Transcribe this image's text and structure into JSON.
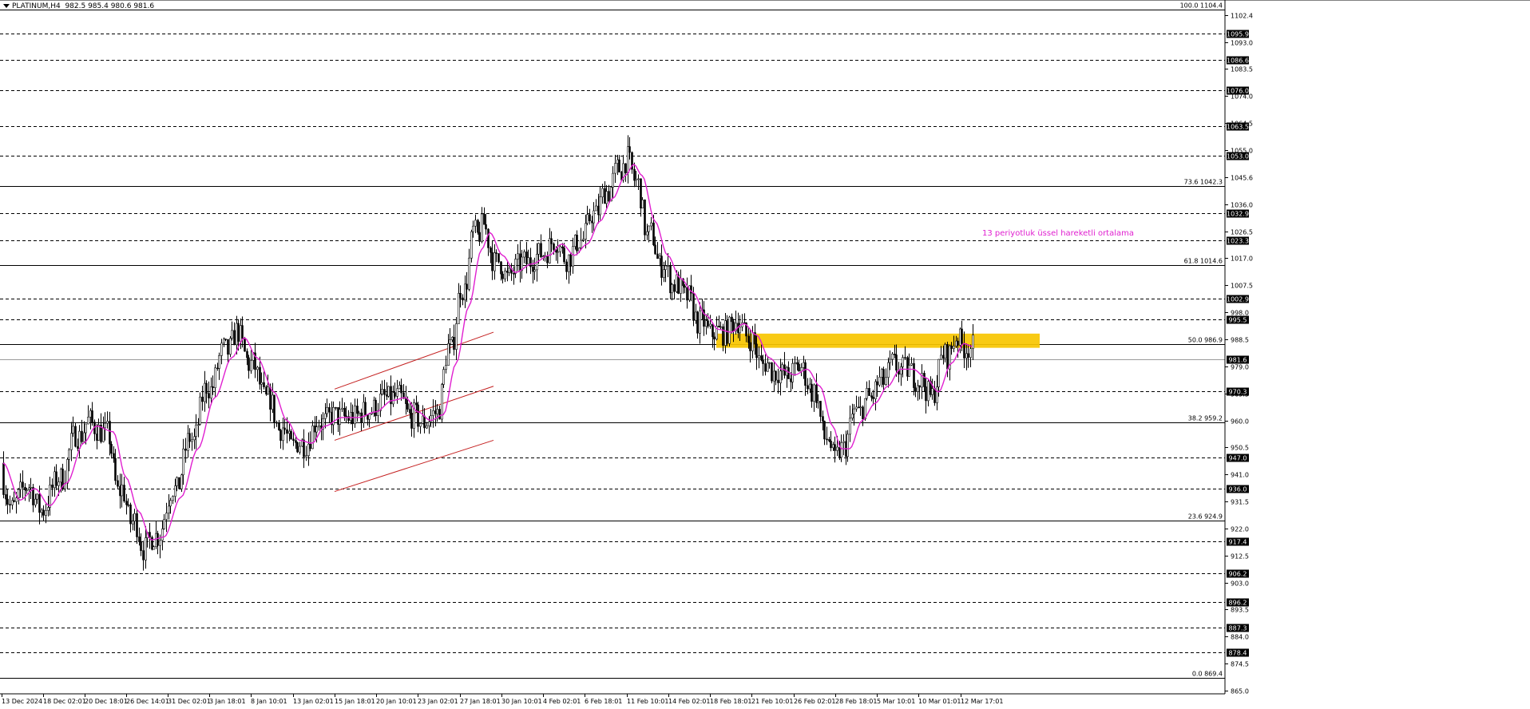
{
  "header": {
    "symbol": "PLATINUM,H4",
    "ohlc": "982.5 985.4 980.6 981.6"
  },
  "annotation_text": "13 periyotluk üssel hareketli ortalama",
  "colors": {
    "candle": "#000000",
    "ema": "#e020d0",
    "channel": "#c42020",
    "zone": "#f7c600",
    "price_tag_bg": "#000000",
    "price_tag_text": "#ffffff",
    "grid_line": "#000000",
    "background": "#ffffff"
  },
  "chart_data": {
    "type": "candlestick",
    "symbol": "PLATINUM",
    "timeframe": "H4",
    "ylim": [
      865.0,
      1104.4
    ],
    "current_price": 981.6,
    "yticks": [
      "1102.4",
      "1093.0",
      "1083.5",
      "1074.0",
      "1064.5",
      "1055.0",
      "1045.6",
      "1036.0",
      "1026.5",
      "1017.0",
      "1007.5",
      "998.0",
      "988.5",
      "979.0",
      "969.5",
      "960.0",
      "950.5",
      "941.0",
      "931.5",
      "922.0",
      "912.5",
      "903.0",
      "893.5",
      "884.0",
      "874.5",
      "865.0"
    ],
    "xticks": [
      "13 Dec 2024",
      "18 Dec 02:01",
      "20 Dec 18:01",
      "26 Dec 14:01",
      "31 Dec 02:01",
      "3 Jan 18:01",
      "8 Jan 10:01",
      "13 Jan 02:01",
      "15 Jan 18:01",
      "20 Jan 10:01",
      "23 Jan 02:01",
      "27 Jan 18:01",
      "30 Jan 10:01",
      "4 Feb 02:01",
      "6 Feb 18:01",
      "11 Feb 10:01",
      "14 Feb 02:01",
      "18 Feb 18:01",
      "21 Feb 10:01",
      "26 Feb 02:01",
      "28 Feb 18:01",
      "5 Mar 10:01",
      "10 Mar 01:01",
      "12 Mar 17:01"
    ],
    "horizontal_levels": [
      {
        "label": "1095.9",
        "value": 1095.9,
        "style": "dashed"
      },
      {
        "label": "1086.6",
        "value": 1086.6,
        "style": "dashed"
      },
      {
        "label": "1076.0",
        "value": 1076.0,
        "style": "dashed"
      },
      {
        "label": "1063.5",
        "value": 1063.5,
        "style": "dashed"
      },
      {
        "label": "1053.0",
        "value": 1053.0,
        "style": "dashed"
      },
      {
        "label": "1032.9",
        "value": 1032.9,
        "style": "dashed"
      },
      {
        "label": "1023.3",
        "value": 1023.3,
        "style": "dashed"
      },
      {
        "label": "1002.9",
        "value": 1002.9,
        "style": "dashed"
      },
      {
        "label": "995.5",
        "value": 995.5,
        "style": "dashed"
      },
      {
        "label": "970.3",
        "value": 970.3,
        "style": "dashed"
      },
      {
        "label": "947.0",
        "value": 947.0,
        "style": "dashed"
      },
      {
        "label": "936.0",
        "value": 936.0,
        "style": "dashed"
      },
      {
        "label": "917.4",
        "value": 917.4,
        "style": "dashed"
      },
      {
        "label": "906.2",
        "value": 906.2,
        "style": "dashed"
      },
      {
        "label": "896.2",
        "value": 896.2,
        "style": "dashed"
      },
      {
        "label": "887.3",
        "value": 887.3,
        "style": "dashed"
      },
      {
        "label": "878.4",
        "value": 878.4,
        "style": "dashed"
      }
    ],
    "fibonacci": [
      {
        "label": "100.0 1104.4",
        "value": 1104.4
      },
      {
        "label": "73.6 1042.3",
        "value": 1042.3
      },
      {
        "label": "61.8 1014.6",
        "value": 1014.6
      },
      {
        "label": "50.0 986.9",
        "value": 986.9
      },
      {
        "label": "38.2 959.2",
        "value": 959.2
      },
      {
        "label": "23.6 924.9",
        "value": 924.9
      },
      {
        "label": "0.0 869.4",
        "value": 869.4
      }
    ],
    "ema_period": 13,
    "ema_waypoints": [
      [
        0,
        945
      ],
      [
        8,
        932
      ],
      [
        15,
        936
      ],
      [
        22,
        930
      ],
      [
        30,
        938
      ],
      [
        38,
        952
      ],
      [
        44,
        958
      ],
      [
        52,
        956
      ],
      [
        58,
        940
      ],
      [
        64,
        928
      ],
      [
        70,
        918
      ],
      [
        76,
        919
      ],
      [
        84,
        933
      ],
      [
        92,
        950
      ],
      [
        100,
        968
      ],
      [
        108,
        982
      ],
      [
        114,
        989
      ],
      [
        120,
        982
      ],
      [
        128,
        970
      ],
      [
        134,
        960
      ],
      [
        140,
        953
      ],
      [
        146,
        952
      ],
      [
        152,
        958
      ],
      [
        160,
        961
      ],
      [
        168,
        961
      ],
      [
        176,
        963
      ],
      [
        184,
        967
      ],
      [
        190,
        968
      ],
      [
        196,
        963
      ],
      [
        202,
        960
      ],
      [
        208,
        962
      ],
      [
        214,
        980
      ],
      [
        220,
        1000
      ],
      [
        226,
        1020
      ],
      [
        230,
        1026
      ],
      [
        236,
        1018
      ],
      [
        242,
        1012
      ],
      [
        250,
        1015
      ],
      [
        258,
        1018
      ],
      [
        264,
        1022
      ],
      [
        270,
        1018
      ],
      [
        276,
        1022
      ],
      [
        282,
        1030
      ],
      [
        288,
        1038
      ],
      [
        294,
        1046
      ],
      [
        298,
        1050
      ],
      [
        302,
        1046
      ],
      [
        308,
        1030
      ],
      [
        314,
        1018
      ],
      [
        320,
        1010
      ],
      [
        326,
        1005
      ],
      [
        332,
        997
      ],
      [
        338,
        992
      ],
      [
        344,
        991
      ],
      [
        350,
        994
      ],
      [
        356,
        990
      ],
      [
        362,
        982
      ],
      [
        368,
        978
      ],
      [
        374,
        976
      ],
      [
        380,
        978
      ],
      [
        386,
        972
      ],
      [
        392,
        958
      ],
      [
        396,
        950
      ],
      [
        400,
        950
      ],
      [
        406,
        960
      ],
      [
        412,
        966
      ],
      [
        418,
        972
      ],
      [
        424,
        978
      ],
      [
        430,
        978
      ],
      [
        436,
        975
      ],
      [
        442,
        970
      ],
      [
        448,
        980
      ],
      [
        454,
        987
      ],
      [
        458,
        986
      ]
    ],
    "channel_lines": [
      {
        "name": "upper",
        "from": {
          "date": "15 Jan",
          "price": 971
        },
        "to": {
          "date": "28 Jan",
          "price": 991
        }
      },
      {
        "name": "middle",
        "from": {
          "date": "15 Jan",
          "price": 953
        },
        "to": {
          "date": "28 Jan",
          "price": 972
        }
      },
      {
        "name": "lower",
        "from": {
          "date": "15 Jan",
          "price": 935
        },
        "to": {
          "date": "28 Jan",
          "price": 953
        }
      }
    ],
    "resistance_zone": {
      "from_price": 985.5,
      "to_price": 990.5,
      "start_date": "18 Feb",
      "end_date": "13 Mar"
    }
  }
}
